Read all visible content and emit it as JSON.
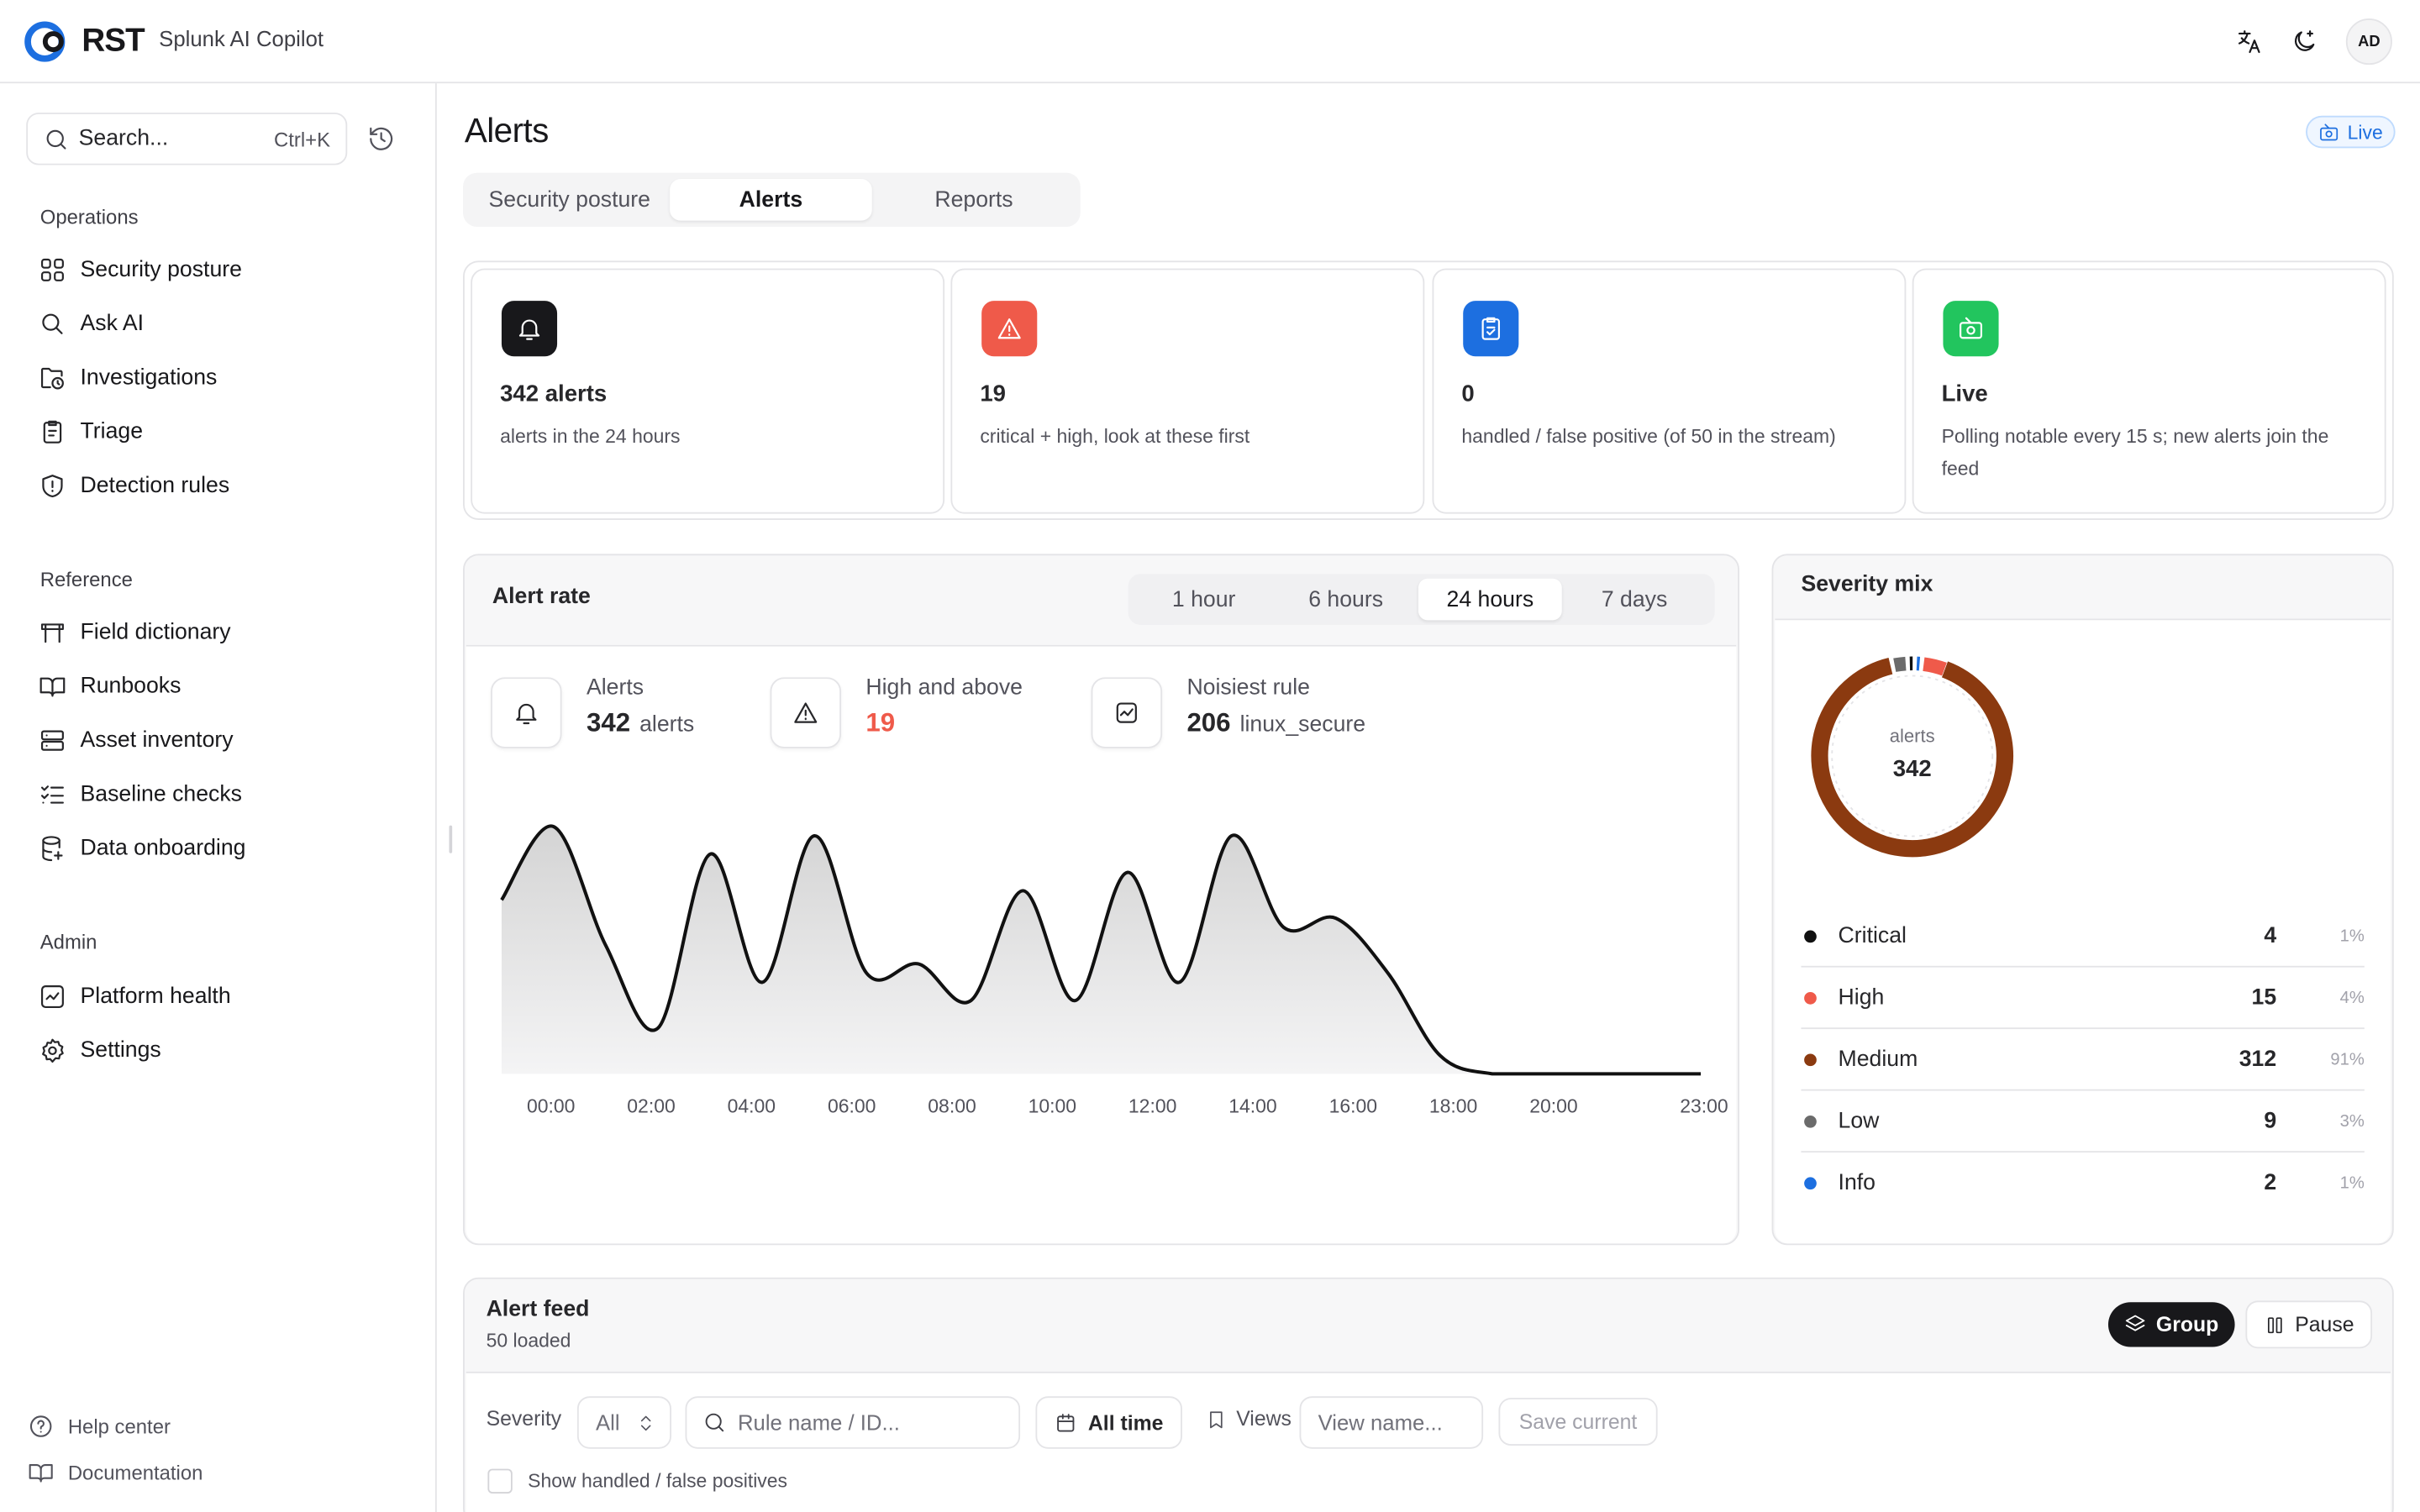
{
  "brand": {
    "logo_text": "RST",
    "app_name": "Splunk AI Copilot",
    "avatar": "AD"
  },
  "sidebar": {
    "search_placeholder": "Search...",
    "search_shortcut": "Ctrl+K",
    "sections": [
      {
        "title": "Operations",
        "items": [
          {
            "label": "Security posture",
            "icon": "grid-icon"
          },
          {
            "label": "Ask AI",
            "icon": "search-icon"
          },
          {
            "label": "Investigations",
            "icon": "folder-clock-icon"
          },
          {
            "label": "Triage",
            "icon": "clipboard-icon"
          },
          {
            "label": "Detection rules",
            "icon": "shield-alert-icon"
          }
        ]
      },
      {
        "title": "Reference",
        "items": [
          {
            "label": "Field dictionary",
            "icon": "table-icon"
          },
          {
            "label": "Runbooks",
            "icon": "book-open-icon"
          },
          {
            "label": "Asset inventory",
            "icon": "server-icon"
          },
          {
            "label": "Baseline checks",
            "icon": "list-checks-icon"
          },
          {
            "label": "Data onboarding",
            "icon": "database-icon"
          }
        ]
      },
      {
        "title": "Admin",
        "items": [
          {
            "label": "Platform health",
            "icon": "activity-icon"
          },
          {
            "label": "Settings",
            "icon": "gear-icon"
          }
        ]
      }
    ],
    "footer": [
      {
        "label": "Help center",
        "icon": "help-icon"
      },
      {
        "label": "Documentation",
        "icon": "book-icon"
      }
    ]
  },
  "page": {
    "title": "Alerts",
    "live_label": "Live",
    "tabs": [
      "Security posture",
      "Alerts",
      "Reports"
    ],
    "active_tab": "Alerts"
  },
  "kpis": [
    {
      "value": "342 alerts",
      "desc": "alerts in the 24 hours",
      "color": "#18181b",
      "icon": "bell-icon"
    },
    {
      "value": "19",
      "desc": "critical + high, look at these first",
      "color": "#ef4444",
      "icon": "warning-icon"
    },
    {
      "value": "0",
      "desc": "handled / false positive (of 50 in the stream)",
      "color": "#1d6fe0",
      "icon": "clipboard-check-icon"
    },
    {
      "value": "Live",
      "desc": "Polling notable every 15 s; new alerts join the feed",
      "color": "#22c55e",
      "icon": "radio-icon"
    }
  ],
  "alert_rate": {
    "title": "Alert rate",
    "ranges": [
      "1 hour",
      "6 hours",
      "24 hours",
      "7 days"
    ],
    "active_range": "24 hours",
    "stats": [
      {
        "label": "Alerts",
        "value": "342",
        "unit": "alerts",
        "icon": "bell-icon"
      },
      {
        "label": "High and above",
        "value": "19",
        "unit": "",
        "icon": "warning-icon",
        "value_color": "#ef4444"
      },
      {
        "label": "Noisiest rule",
        "value": "206",
        "unit": "linux_secure",
        "icon": "chart-box-icon"
      }
    ]
  },
  "chart_data": {
    "type": "area",
    "x": [
      "00:00",
      "01:00",
      "02:00",
      "03:00",
      "04:00",
      "05:00",
      "06:00",
      "07:00",
      "08:00",
      "09:00",
      "10:00",
      "11:00",
      "12:00",
      "13:00",
      "14:00",
      "15:00",
      "16:00",
      "17:00",
      "18:00",
      "19:00",
      "20:00",
      "21:00",
      "22:00",
      "23:00"
    ],
    "values": [
      19,
      27,
      14,
      5,
      24,
      10,
      26,
      11,
      12,
      8,
      20,
      8,
      22,
      10,
      26,
      16,
      17,
      11,
      2,
      0,
      0,
      0,
      0,
      0
    ],
    "tick_labels": [
      "00:00",
      "02:00",
      "04:00",
      "06:00",
      "08:00",
      "10:00",
      "12:00",
      "14:00",
      "16:00",
      "18:00",
      "20:00",
      "23:00"
    ],
    "ylim": [
      0,
      30
    ],
    "grid": false,
    "legend": "none"
  },
  "severity": {
    "title": "Severity mix",
    "center_label": "alerts",
    "center_value": "342",
    "rows": [
      {
        "name": "Critical",
        "count": "4",
        "pct": "1%",
        "color": "#111111"
      },
      {
        "name": "High",
        "count": "15",
        "pct": "4%",
        "color": "#ef5a4a"
      },
      {
        "name": "Medium",
        "count": "312",
        "pct": "91%",
        "color": "#8b3a10"
      },
      {
        "name": "Low",
        "count": "9",
        "pct": "3%",
        "color": "#6b6b6b"
      },
      {
        "name": "Info",
        "count": "2",
        "pct": "1%",
        "color": "#1d6fe0"
      }
    ]
  },
  "feed": {
    "title": "Alert feed",
    "subtitle": "50 loaded",
    "group_label": "Group",
    "pause_label": "Pause",
    "severity_label": "Severity",
    "severity_value": "All",
    "rule_placeholder": "Rule name / ID...",
    "time_label": "All time",
    "views_label": "Views",
    "view_placeholder": "View name...",
    "save_label": "Save current",
    "show_handled_label": "Show handled / false positives"
  }
}
